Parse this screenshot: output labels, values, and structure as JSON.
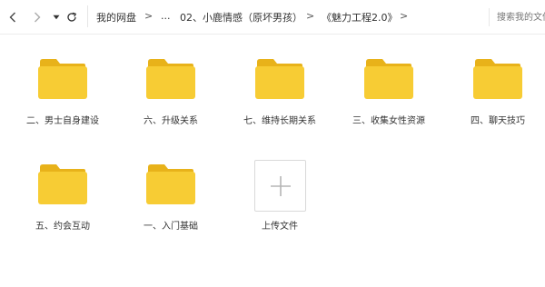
{
  "toolbar": {
    "back_icon": "chevron-left-icon",
    "forward_icon": "chevron-right-icon",
    "dropdown_icon": "caret-down-icon",
    "refresh_icon": "refresh-icon"
  },
  "breadcrumb": {
    "root": "我的网盘",
    "separator": ">",
    "ellipsis": "...",
    "level1": "02、小鹿情感（原坏男孩）",
    "level2": "《魅力工程2.0》"
  },
  "search": {
    "placeholder": "搜索我的文件"
  },
  "colors": {
    "folder_body": "#F7CC34",
    "folder_tab": "#E8B21A"
  },
  "folders": [
    {
      "label": "二、男士自身建设"
    },
    {
      "label": "六、升级关系"
    },
    {
      "label": "七、维持长期关系"
    },
    {
      "label": "三、收集女性资源"
    },
    {
      "label": "四、聊天技巧"
    },
    {
      "label": "五、约会互动"
    },
    {
      "label": "一、入门基础"
    }
  ],
  "upload": {
    "label": "上传文件",
    "icon": "plus-icon"
  }
}
